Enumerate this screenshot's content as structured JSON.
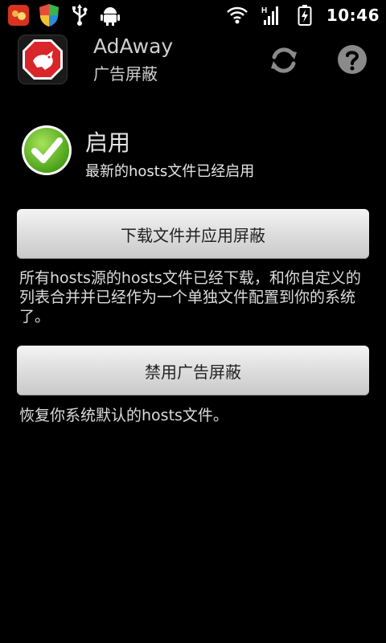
{
  "statusbar": {
    "time": "10:46",
    "left_icons": [
      "app-notification-icon",
      "shield-notification-icon",
      "usb-icon",
      "android-debug-icon"
    ],
    "right_icons": [
      "wifi-icon",
      "signal-icon",
      "battery-charging-icon"
    ]
  },
  "actionbar": {
    "title": "AdAway",
    "subtitle": "广告屏蔽",
    "logo_icon": "adaway-logo-icon",
    "refresh_icon": "refresh-icon",
    "help_icon": "help-icon"
  },
  "status": {
    "icon": "check-icon",
    "title": "启用",
    "description": "最新的hosts文件已经启用"
  },
  "actions": {
    "download_button": "下载文件并应用屏蔽",
    "download_description": "所有hosts源的hosts文件已经下载，和你自定义的列表合并并已经作为一个单独文件配置到你的系统了。",
    "disable_button": "禁用广告屏蔽",
    "disable_description": "恢复你系统默认的hosts文件。"
  },
  "colors": {
    "background": "#000000",
    "check_green": "#6cc21f",
    "logo_red": "#d9262b",
    "button_gray": "#d9d9d9"
  }
}
